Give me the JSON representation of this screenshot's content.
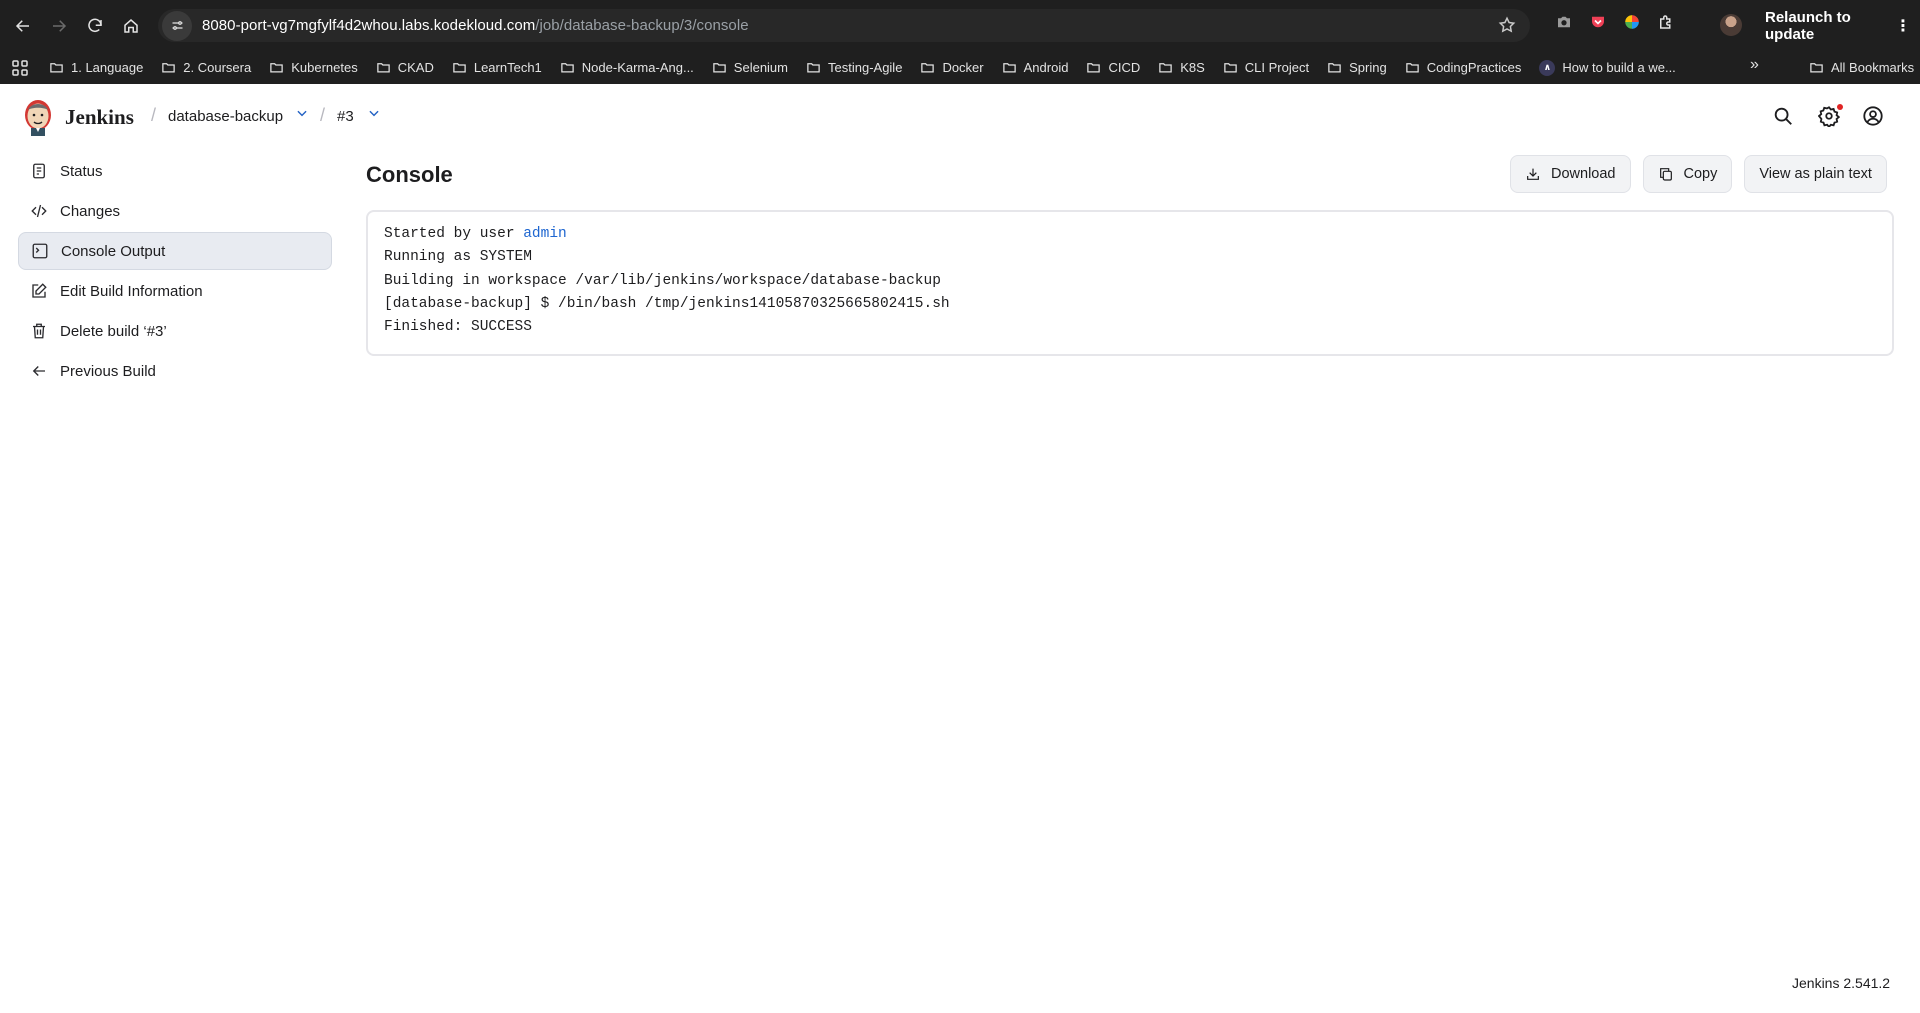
{
  "browser": {
    "url_host": "8080-port-vg7mgfylf4d2whou.labs.kodekloud.com",
    "url_path": "/job/database-backup/3/console",
    "relaunch_label": "Relaunch to update",
    "bookmarks": [
      {
        "label": "1. Language",
        "icon": "folder-icon"
      },
      {
        "label": "2. Coursera",
        "icon": "folder-icon"
      },
      {
        "label": "Kubernetes",
        "icon": "folder-icon"
      },
      {
        "label": "CKAD",
        "icon": "folder-icon"
      },
      {
        "label": "LearnTech1",
        "icon": "folder-icon"
      },
      {
        "label": "Node-Karma-Ang...",
        "icon": "folder-icon"
      },
      {
        "label": "Selenium",
        "icon": "folder-icon"
      },
      {
        "label": "Testing-Agile",
        "icon": "folder-icon"
      },
      {
        "label": "Docker",
        "icon": "folder-icon"
      },
      {
        "label": "Android",
        "icon": "folder-icon"
      },
      {
        "label": "CICD",
        "icon": "folder-icon"
      },
      {
        "label": "K8S",
        "icon": "folder-icon"
      },
      {
        "label": "CLI Project",
        "icon": "folder-icon"
      },
      {
        "label": "Spring",
        "icon": "folder-icon"
      },
      {
        "label": "CodingPractices",
        "icon": "folder-icon"
      },
      {
        "label": "How to build a we...",
        "icon": "site-favicon"
      }
    ],
    "all_bookmarks_label": "All Bookmarks"
  },
  "header": {
    "brand": "Jenkins",
    "breadcrumb_job": "database-backup",
    "breadcrumb_build": "#3"
  },
  "sidebar": {
    "items": [
      {
        "label": "Status",
        "icon": "status-icon",
        "active": false
      },
      {
        "label": "Changes",
        "icon": "code-icon",
        "active": false
      },
      {
        "label": "Console Output",
        "icon": "terminal-icon",
        "active": true
      },
      {
        "label": "Edit Build Information",
        "icon": "edit-icon",
        "active": false
      },
      {
        "label": "Delete build ‘#3’",
        "icon": "trash-icon",
        "active": false
      },
      {
        "label": "Previous Build",
        "icon": "arrow-left-icon",
        "active": false
      }
    ]
  },
  "main": {
    "title": "Console",
    "actions": {
      "download": "Download",
      "copy": "Copy",
      "plain_text": "View as plain text"
    },
    "console": {
      "line1_prefix": "Started by user ",
      "line1_user": "admin",
      "line2": "Running as SYSTEM",
      "line3": "Building in workspace /var/lib/jenkins/workspace/database-backup",
      "line4": "[database-backup] $ /bin/bash /tmp/jenkins14105870325665802415.sh",
      "line5": "Finished: SUCCESS"
    }
  },
  "footer": {
    "version": "Jenkins 2.541.2"
  },
  "colors": {
    "link": "#1e66d0",
    "breadcrumb_chevron": "#2563c4",
    "active_bg": "#e8ebf1",
    "chrome_bg": "#1f1f1f"
  }
}
